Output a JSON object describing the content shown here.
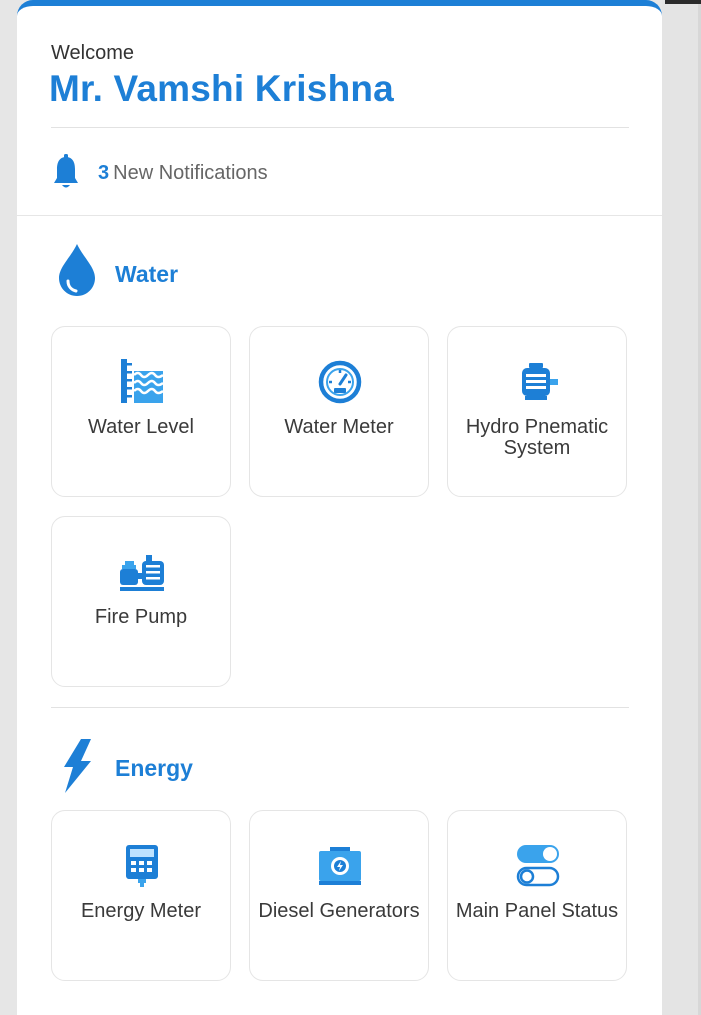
{
  "header": {
    "welcome": "Welcome",
    "user_name": "Mr. Vamshi Krishna"
  },
  "notifications": {
    "count": "3",
    "label": "New Notifications",
    "icon": "bell-icon"
  },
  "sections": [
    {
      "title": "Water",
      "icon": "water-drop-icon",
      "items": [
        {
          "label": "Water Level",
          "icon": "water-level-icon"
        },
        {
          "label": "Water Meter",
          "icon": "water-meter-icon"
        },
        {
          "label": "Hydro Pnematic System",
          "icon": "hydro-pneumatic-icon"
        },
        {
          "label": "Fire Pump",
          "icon": "fire-pump-icon"
        }
      ]
    },
    {
      "title": "Energy",
      "icon": "lightning-icon",
      "items": [
        {
          "label": "Energy Meter",
          "icon": "energy-meter-icon"
        },
        {
          "label": "Diesel Generators",
          "icon": "diesel-generator-icon"
        },
        {
          "label": "Main Panel Status",
          "icon": "panel-status-icon"
        }
      ]
    }
  ],
  "colors": {
    "accent": "#1d7fd6",
    "text": "#3a3a3a",
    "muted": "#666666",
    "border": "#e5e5e5",
    "background": "#e6e6e6"
  }
}
